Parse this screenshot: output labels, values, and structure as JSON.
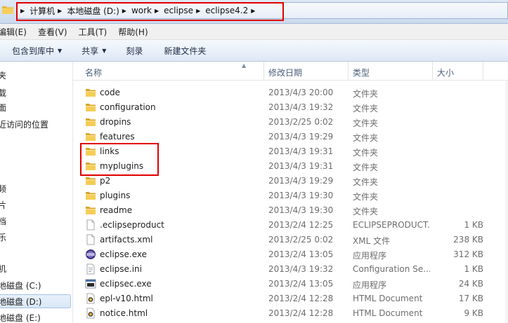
{
  "address_bar": {
    "crumbs": [
      "计算机",
      "本地磁盘 (D:)",
      "work",
      "eclipse",
      "eclipse4.2"
    ]
  },
  "menu": {
    "items": [
      "编辑(E)",
      "查看(V)",
      "工具(T)",
      "帮助(H)"
    ]
  },
  "toolbar": {
    "include_library": "包含到库中",
    "share": "共享",
    "burn": "刻录",
    "new_folder": "新建文件夹"
  },
  "nav": {
    "items": [
      "夹",
      "载",
      "面",
      "近访问的位置",
      "频",
      "片",
      "档",
      "乐",
      "机",
      "地磁盘 (C:)",
      "地磁盘 (D:)",
      "地磁盘 (E:)"
    ]
  },
  "columns": {
    "name": "名称",
    "date": "修改日期",
    "type": "类型",
    "size": "大小"
  },
  "files": [
    {
      "name": "code",
      "date": "2013/4/3 20:00",
      "type": "文件夹",
      "size": "",
      "icon": "folder-icon"
    },
    {
      "name": "configuration",
      "date": "2013/4/3 19:32",
      "type": "文件夹",
      "size": "",
      "icon": "folder-icon"
    },
    {
      "name": "dropins",
      "date": "2013/2/25 0:02",
      "type": "文件夹",
      "size": "",
      "icon": "folder-icon"
    },
    {
      "name": "features",
      "date": "2013/4/3 19:29",
      "type": "文件夹",
      "size": "",
      "icon": "folder-icon"
    },
    {
      "name": "links",
      "date": "2013/4/3 19:31",
      "type": "文件夹",
      "size": "",
      "icon": "folder-icon"
    },
    {
      "name": "myplugins",
      "date": "2013/4/3 19:31",
      "type": "文件夹",
      "size": "",
      "icon": "folder-icon"
    },
    {
      "name": "p2",
      "date": "2013/4/3 19:29",
      "type": "文件夹",
      "size": "",
      "icon": "folder-icon"
    },
    {
      "name": "plugins",
      "date": "2013/4/3 19:30",
      "type": "文件夹",
      "size": "",
      "icon": "folder-icon"
    },
    {
      "name": "readme",
      "date": "2013/4/3 19:30",
      "type": "文件夹",
      "size": "",
      "icon": "folder-icon"
    },
    {
      "name": ".eclipseproduct",
      "date": "2013/2/4 12:25",
      "type": "ECLIPSEPRODUCT...",
      "size": "1 KB",
      "icon": "file-icon"
    },
    {
      "name": "artifacts.xml",
      "date": "2013/2/25 0:02",
      "type": "XML 文件",
      "size": "238 KB",
      "icon": "file-icon"
    },
    {
      "name": "eclipse.exe",
      "date": "2013/2/4 13:05",
      "type": "应用程序",
      "size": "312 KB",
      "icon": "eclipse-app-icon"
    },
    {
      "name": "eclipse.ini",
      "date": "2013/4/3 19:32",
      "type": "Configuration Se...",
      "size": "1 KB",
      "icon": "config-file-icon"
    },
    {
      "name": "eclipsec.exe",
      "date": "2013/2/4 13:05",
      "type": "应用程序",
      "size": "24 KB",
      "icon": "console-app-icon"
    },
    {
      "name": "epl-v10.html",
      "date": "2013/2/4 12:28",
      "type": "HTML Document",
      "size": "17 KB",
      "icon": "html-file-icon"
    },
    {
      "name": "notice.html",
      "date": "2013/2/4 12:28",
      "type": "HTML Document",
      "size": "9 KB",
      "icon": "html-file-icon"
    }
  ]
}
